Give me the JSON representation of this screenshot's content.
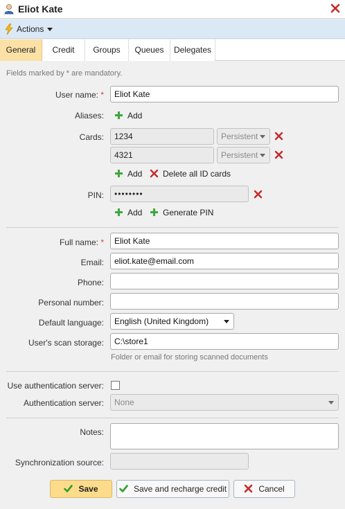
{
  "window": {
    "title": "Eliot Kate"
  },
  "actions": {
    "label": "Actions"
  },
  "tabs": [
    {
      "label": "General"
    },
    {
      "label": "Credit"
    },
    {
      "label": "Groups"
    },
    {
      "label": "Queues"
    },
    {
      "label": "Delegates"
    }
  ],
  "form": {
    "mandatory_hint": "Fields marked by * are mandatory.",
    "username": {
      "label": "User name:",
      "required": "*",
      "value": "Eliot Kate"
    },
    "aliases": {
      "label": "Aliases:",
      "add": "Add"
    },
    "cards": {
      "label": "Cards:",
      "items": [
        {
          "value": "1234",
          "type": "Persistent"
        },
        {
          "value": "4321",
          "type": "Persistent"
        }
      ],
      "add": "Add",
      "delete_all": "Delete all ID cards"
    },
    "pin": {
      "label": "PIN:",
      "value": "••••••••",
      "add": "Add",
      "generate": "Generate PIN"
    },
    "fullname": {
      "label": "Full name:",
      "required": "*",
      "value": "Eliot Kate"
    },
    "email": {
      "label": "Email:",
      "value": "eliot.kate@email.com"
    },
    "phone": {
      "label": "Phone:",
      "value": ""
    },
    "personal_number": {
      "label": "Personal number:",
      "value": ""
    },
    "default_language": {
      "label": "Default language:",
      "value": "English (United Kingdom)"
    },
    "scan_storage": {
      "label": "User's scan storage:",
      "value": "C:\\store1",
      "hint": "Folder or email for storing scanned documents"
    },
    "use_auth_server": {
      "label": "Use authentication server:",
      "checked": false
    },
    "auth_server": {
      "label": "Authentication server:",
      "value": "None"
    },
    "notes": {
      "label": "Notes:",
      "value": ""
    },
    "sync_source": {
      "label": "Synchronization source:",
      "value": ""
    }
  },
  "buttons": {
    "save": "Save",
    "save_recharge": "Save and recharge credit",
    "cancel": "Cancel"
  },
  "colors": {
    "active_tab": "#fce1a6",
    "actions_bar": "#dbe8f6",
    "primary_button": "#fcdc8a",
    "add_icon": "#3aa93a",
    "delete_icon": "#c62828"
  }
}
